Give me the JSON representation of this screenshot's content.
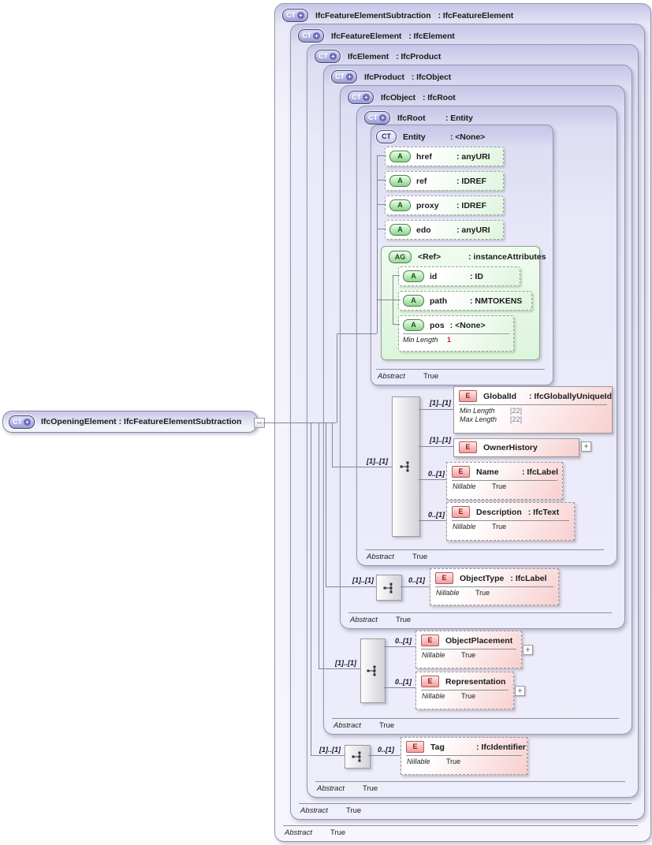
{
  "icons": {
    "ct": "CT",
    "attribute": "A",
    "attribute_group": "AG",
    "element": "E",
    "expand": "+"
  },
  "source": {
    "name": "IfcOpeningElement",
    "type_label": ": IfcFeatureElementSubtraction"
  },
  "levels": [
    {
      "title": "IfcFeatureElementSubtraction",
      "type_label": ": IfcFeatureElement",
      "footer": {
        "label": "Abstract",
        "value": "True"
      }
    },
    {
      "title": "IfcFeatureElement",
      "type_label": ": IfcElement",
      "footer": {
        "label": "Abstract",
        "value": "True"
      }
    },
    {
      "title": "IfcElement",
      "type_label": ": IfcProduct",
      "footer": {
        "label": "Abstract",
        "value": "True"
      }
    },
    {
      "title": "IfcProduct",
      "type_label": ": IfcObject",
      "footer": {
        "label": "Abstract",
        "value": "True"
      }
    },
    {
      "title": "IfcObject",
      "type_label": ": IfcRoot",
      "footer": {
        "label": "Abstract",
        "value": "True"
      }
    },
    {
      "title": "IfcRoot",
      "type_label": ": Entity",
      "footer": {
        "label": "Abstract",
        "value": "True"
      }
    }
  ],
  "entity": {
    "title": "Entity",
    "type_label": ": <None>",
    "footer": {
      "label": "Abstract",
      "value": "True"
    },
    "attributes": [
      {
        "name": "href",
        "type_label": ": anyURI"
      },
      {
        "name": "ref",
        "type_label": ": IDREF"
      },
      {
        "name": "proxy",
        "type_label": ": IDREF"
      },
      {
        "name": "edo",
        "type_label": ": anyURI"
      }
    ],
    "group": {
      "name": "<Ref>",
      "type_label": ": instanceAttributes",
      "attributes": [
        {
          "name": "id",
          "type_label": ": ID"
        },
        {
          "name": "path",
          "type_label": ": NMTOKENS"
        },
        {
          "name": "pos",
          "type_label": ": <None>",
          "facets": [
            {
              "label": "Min Length",
              "value": "1"
            }
          ]
        }
      ]
    }
  },
  "sequences": {
    "root": {
      "cardinality": "[1]..[1]"
    },
    "object": {
      "cardinality": "[1]..[1]"
    },
    "product": {
      "cardinality": "[1]..[1]"
    },
    "element": {
      "cardinality": "[1]..[1]"
    }
  },
  "elements": {
    "global_id": {
      "cardinality": "[1]..[1]",
      "name": "GlobalId",
      "type_label": ": IfcGloballyUniqueId",
      "facets": [
        {
          "label": "Min Length",
          "value": "[22]"
        },
        {
          "label": "Max Length",
          "value": "[22]"
        }
      ]
    },
    "owner_history": {
      "cardinality": "[1]..[1]",
      "name": "OwnerHistory"
    },
    "name": {
      "cardinality": "0..[1]",
      "name": "Name",
      "type_label": ": IfcLabel",
      "facets": [
        {
          "label": "Nillable",
          "value": "True"
        }
      ]
    },
    "description": {
      "cardinality": "0..[1]",
      "name": "Description",
      "type_label": ": IfcText",
      "facets": [
        {
          "label": "Nillable",
          "value": "True"
        }
      ]
    },
    "object_type": {
      "cardinality": "0..[1]",
      "name": "ObjectType",
      "type_label": ": IfcLabel",
      "facets": [
        {
          "label": "Nillable",
          "value": "True"
        }
      ]
    },
    "object_placement": {
      "cardinality": "0..[1]",
      "name": "ObjectPlacement",
      "facets": [
        {
          "label": "Nillable",
          "value": "True"
        }
      ]
    },
    "representation": {
      "cardinality": "0..[1]",
      "name": "Representation",
      "facets": [
        {
          "label": "Nillable",
          "value": "True"
        }
      ]
    },
    "tag": {
      "cardinality": "0..[1]",
      "name": "Tag",
      "type_label": ": IfcIdentifier",
      "facets": [
        {
          "label": "Nillable",
          "value": "True"
        }
      ]
    }
  },
  "colors": {
    "lavender_border": "#9595ab",
    "line": "#85859a",
    "green": "#def5de",
    "pink": "#f8cfcf",
    "facet_dim": "#7d7d99",
    "facet_red": "#cc2020"
  }
}
